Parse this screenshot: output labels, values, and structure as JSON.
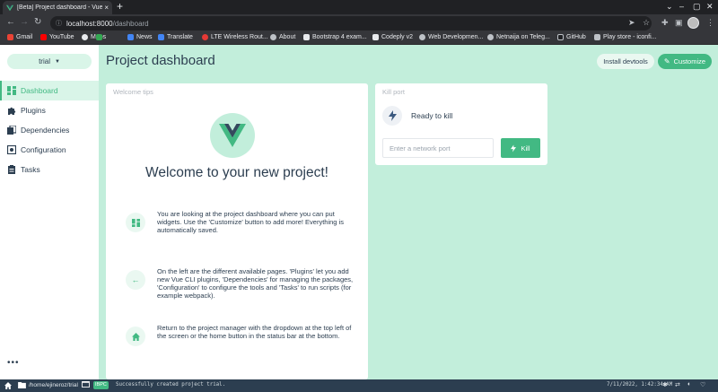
{
  "browser": {
    "tab_title": "[Beta] Project dashboard - Vue",
    "tab_close": "×",
    "new_tab": "+",
    "url_host": "localhost:8000",
    "url_path": "/dashboard",
    "window_controls": [
      "⌄",
      "–",
      "▢",
      "✕"
    ],
    "nav_icons": [
      "←",
      "→",
      "↻"
    ],
    "toolbar_icons": [
      "send-icon",
      "star-icon",
      "extensions-icon",
      "sidepanel-icon",
      "profile-avatar",
      "menu-icon"
    ]
  },
  "bookmarks": [
    {
      "label": "Gmail",
      "color": "#ea4335"
    },
    {
      "label": "YouTube",
      "color": "#ff0000"
    },
    {
      "label": "Maps",
      "color": "#34a853"
    },
    {
      "label": "News",
      "color": "#4285f4"
    },
    {
      "label": "Translate",
      "color": "#4285f4"
    },
    {
      "label": "LTE Wireless Rout...",
      "color": "#e53935"
    },
    {
      "label": "About",
      "color": "#bdc1c6"
    },
    {
      "label": "Bootstrap 4 exam...",
      "color": "#e8eaed"
    },
    {
      "label": "Codeply v2",
      "color": "#e8eaed"
    },
    {
      "label": "Web Developmen...",
      "color": "#bdc1c6"
    },
    {
      "label": "Netnaija on Teleg...",
      "color": "#bdc1c6"
    },
    {
      "label": "GitHub",
      "color": "#202124"
    },
    {
      "label": "Play store - iconfi...",
      "color": "#bdc1c6"
    }
  ],
  "sidebar": {
    "project": "trial",
    "items": [
      {
        "label": "Dashboard",
        "icon": "dashboard-icon",
        "active": true
      },
      {
        "label": "Plugins",
        "icon": "puzzle-icon",
        "active": false
      },
      {
        "label": "Dependencies",
        "icon": "dependencies-icon",
        "active": false
      },
      {
        "label": "Configuration",
        "icon": "gear-icon",
        "active": false
      },
      {
        "label": "Tasks",
        "icon": "clipboard-icon",
        "active": false
      }
    ],
    "more": "•••"
  },
  "header": {
    "title": "Project dashboard",
    "devtools_label": "Install devtools",
    "customize_label": "Customize"
  },
  "welcome": {
    "widget_title": "Welcome tips",
    "title": "Welcome to your new project!",
    "tips": [
      {
        "icon": "dashboard-icon",
        "text": "You are looking at the project dashboard where you can put widgets. Use the 'Customize' button to add more! Everything is automatically saved."
      },
      {
        "icon": "arrow-left-icon",
        "text": "On the left are the different available pages. 'Plugins' let you add new Vue CLI plugins, 'Dependencies' for managing the packages, 'Configuration' to configure the tools and 'Tasks' to run scripts (for example webpack)."
      },
      {
        "icon": "home-icon",
        "text": "Return to the project manager with the dropdown at the top left of the screen or the home button in the status bar at the bottom."
      }
    ]
  },
  "kill_port": {
    "widget_title": "Kill port",
    "status": "Ready to kill",
    "placeholder": "Enter a network port",
    "kill_label": "Kill"
  },
  "statusbar": {
    "path": "/home/ejineroz/trial",
    "badge": "IBPC",
    "message": "Successfully created project trial.",
    "time": "7/11/2022, 1:42:34 AM"
  },
  "colors": {
    "accent": "#42b983",
    "app_bg": "#c2eedb",
    "text": "#2c3e50",
    "statusbar": "#2c3e50"
  }
}
